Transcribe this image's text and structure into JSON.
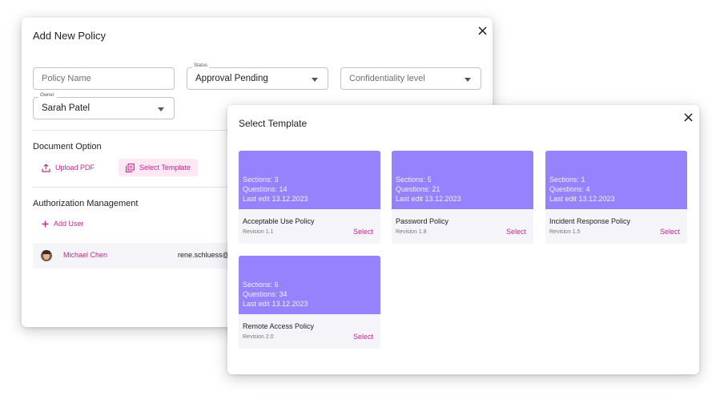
{
  "policy_dialog": {
    "title": "Add New Policy",
    "close_symbol": "×",
    "policy_name": {
      "placeholder": "Policy Name",
      "value": ""
    },
    "status": {
      "label": "Status",
      "value": "Approval Pending"
    },
    "confidentiality": {
      "placeholder": "Confidentiality level",
      "value": ""
    },
    "owner": {
      "label": "Owner",
      "value": "Sarah Patel"
    },
    "document_option": {
      "title": "Document Option",
      "upload_label": "Upload PDF",
      "upload_icon": "upload-icon",
      "template_label": "Select Template",
      "template_icon": "template-icon"
    },
    "authorization": {
      "title": "Authorization Management",
      "add_user_label": "Add User",
      "users": [
        {
          "name": "Michael Chen",
          "email": "rene.schluess@"
        }
      ]
    }
  },
  "template_dialog": {
    "title": "Select Template",
    "close_symbol": "×",
    "select_label": "Select",
    "templates": [
      {
        "sections": "Sections: 3",
        "questions": "Questions: 14",
        "last_edit": "Last edit 13.12.2023",
        "name": "Acceptable Use Policy",
        "revision": "Revision 1.1"
      },
      {
        "sections": "Sections: 5",
        "questions": "Questions: 21",
        "last_edit": "Last edit 13.12.2023",
        "name": "Password Policy",
        "revision": "Revision 1.8"
      },
      {
        "sections": "Sections: 1",
        "questions": "Questions: 4",
        "last_edit": "Last edit 13.12.2023",
        "name": "Incident Response Policy",
        "revision": "Revision 1.5"
      },
      {
        "sections": "Sections: 6",
        "questions": "Questions: 34",
        "last_edit": "Last edit 13.12.2023",
        "name": "Remote Access Policy",
        "revision": "Revision 2.0"
      }
    ]
  },
  "colors": {
    "accent": "#c2268f",
    "card_banner": "#9682fc",
    "pill_bg": "#fde8f4",
    "row_bg": "#f5f4f8"
  }
}
